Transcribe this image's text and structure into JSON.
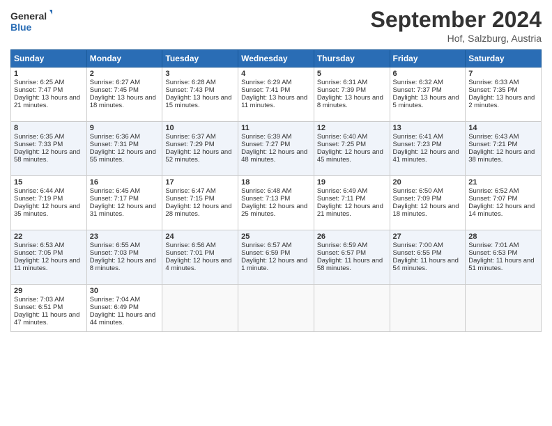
{
  "logo": {
    "line1": "General",
    "line2": "Blue"
  },
  "title": "September 2024",
  "location": "Hof, Salzburg, Austria",
  "days_of_week": [
    "Sunday",
    "Monday",
    "Tuesday",
    "Wednesday",
    "Thursday",
    "Friday",
    "Saturday"
  ],
  "weeks": [
    [
      {
        "day": 1,
        "sunrise": "Sunrise: 6:25 AM",
        "sunset": "Sunset: 7:47 PM",
        "daylight": "Daylight: 13 hours and 21 minutes."
      },
      {
        "day": 2,
        "sunrise": "Sunrise: 6:27 AM",
        "sunset": "Sunset: 7:45 PM",
        "daylight": "Daylight: 13 hours and 18 minutes."
      },
      {
        "day": 3,
        "sunrise": "Sunrise: 6:28 AM",
        "sunset": "Sunset: 7:43 PM",
        "daylight": "Daylight: 13 hours and 15 minutes."
      },
      {
        "day": 4,
        "sunrise": "Sunrise: 6:29 AM",
        "sunset": "Sunset: 7:41 PM",
        "daylight": "Daylight: 13 hours and 11 minutes."
      },
      {
        "day": 5,
        "sunrise": "Sunrise: 6:31 AM",
        "sunset": "Sunset: 7:39 PM",
        "daylight": "Daylight: 13 hours and 8 minutes."
      },
      {
        "day": 6,
        "sunrise": "Sunrise: 6:32 AM",
        "sunset": "Sunset: 7:37 PM",
        "daylight": "Daylight: 13 hours and 5 minutes."
      },
      {
        "day": 7,
        "sunrise": "Sunrise: 6:33 AM",
        "sunset": "Sunset: 7:35 PM",
        "daylight": "Daylight: 13 hours and 2 minutes."
      }
    ],
    [
      {
        "day": 8,
        "sunrise": "Sunrise: 6:35 AM",
        "sunset": "Sunset: 7:33 PM",
        "daylight": "Daylight: 12 hours and 58 minutes."
      },
      {
        "day": 9,
        "sunrise": "Sunrise: 6:36 AM",
        "sunset": "Sunset: 7:31 PM",
        "daylight": "Daylight: 12 hours and 55 minutes."
      },
      {
        "day": 10,
        "sunrise": "Sunrise: 6:37 AM",
        "sunset": "Sunset: 7:29 PM",
        "daylight": "Daylight: 12 hours and 52 minutes."
      },
      {
        "day": 11,
        "sunrise": "Sunrise: 6:39 AM",
        "sunset": "Sunset: 7:27 PM",
        "daylight": "Daylight: 12 hours and 48 minutes."
      },
      {
        "day": 12,
        "sunrise": "Sunrise: 6:40 AM",
        "sunset": "Sunset: 7:25 PM",
        "daylight": "Daylight: 12 hours and 45 minutes."
      },
      {
        "day": 13,
        "sunrise": "Sunrise: 6:41 AM",
        "sunset": "Sunset: 7:23 PM",
        "daylight": "Daylight: 12 hours and 41 minutes."
      },
      {
        "day": 14,
        "sunrise": "Sunrise: 6:43 AM",
        "sunset": "Sunset: 7:21 PM",
        "daylight": "Daylight: 12 hours and 38 minutes."
      }
    ],
    [
      {
        "day": 15,
        "sunrise": "Sunrise: 6:44 AM",
        "sunset": "Sunset: 7:19 PM",
        "daylight": "Daylight: 12 hours and 35 minutes."
      },
      {
        "day": 16,
        "sunrise": "Sunrise: 6:45 AM",
        "sunset": "Sunset: 7:17 PM",
        "daylight": "Daylight: 12 hours and 31 minutes."
      },
      {
        "day": 17,
        "sunrise": "Sunrise: 6:47 AM",
        "sunset": "Sunset: 7:15 PM",
        "daylight": "Daylight: 12 hours and 28 minutes."
      },
      {
        "day": 18,
        "sunrise": "Sunrise: 6:48 AM",
        "sunset": "Sunset: 7:13 PM",
        "daylight": "Daylight: 12 hours and 25 minutes."
      },
      {
        "day": 19,
        "sunrise": "Sunrise: 6:49 AM",
        "sunset": "Sunset: 7:11 PM",
        "daylight": "Daylight: 12 hours and 21 minutes."
      },
      {
        "day": 20,
        "sunrise": "Sunrise: 6:50 AM",
        "sunset": "Sunset: 7:09 PM",
        "daylight": "Daylight: 12 hours and 18 minutes."
      },
      {
        "day": 21,
        "sunrise": "Sunrise: 6:52 AM",
        "sunset": "Sunset: 7:07 PM",
        "daylight": "Daylight: 12 hours and 14 minutes."
      }
    ],
    [
      {
        "day": 22,
        "sunrise": "Sunrise: 6:53 AM",
        "sunset": "Sunset: 7:05 PM",
        "daylight": "Daylight: 12 hours and 11 minutes."
      },
      {
        "day": 23,
        "sunrise": "Sunrise: 6:55 AM",
        "sunset": "Sunset: 7:03 PM",
        "daylight": "Daylight: 12 hours and 8 minutes."
      },
      {
        "day": 24,
        "sunrise": "Sunrise: 6:56 AM",
        "sunset": "Sunset: 7:01 PM",
        "daylight": "Daylight: 12 hours and 4 minutes."
      },
      {
        "day": 25,
        "sunrise": "Sunrise: 6:57 AM",
        "sunset": "Sunset: 6:59 PM",
        "daylight": "Daylight: 12 hours and 1 minute."
      },
      {
        "day": 26,
        "sunrise": "Sunrise: 6:59 AM",
        "sunset": "Sunset: 6:57 PM",
        "daylight": "Daylight: 11 hours and 58 minutes."
      },
      {
        "day": 27,
        "sunrise": "Sunrise: 7:00 AM",
        "sunset": "Sunset: 6:55 PM",
        "daylight": "Daylight: 11 hours and 54 minutes."
      },
      {
        "day": 28,
        "sunrise": "Sunrise: 7:01 AM",
        "sunset": "Sunset: 6:53 PM",
        "daylight": "Daylight: 11 hours and 51 minutes."
      }
    ],
    [
      {
        "day": 29,
        "sunrise": "Sunrise: 7:03 AM",
        "sunset": "Sunset: 6:51 PM",
        "daylight": "Daylight: 11 hours and 47 minutes."
      },
      {
        "day": 30,
        "sunrise": "Sunrise: 7:04 AM",
        "sunset": "Sunset: 6:49 PM",
        "daylight": "Daylight: 11 hours and 44 minutes."
      },
      null,
      null,
      null,
      null,
      null
    ]
  ]
}
